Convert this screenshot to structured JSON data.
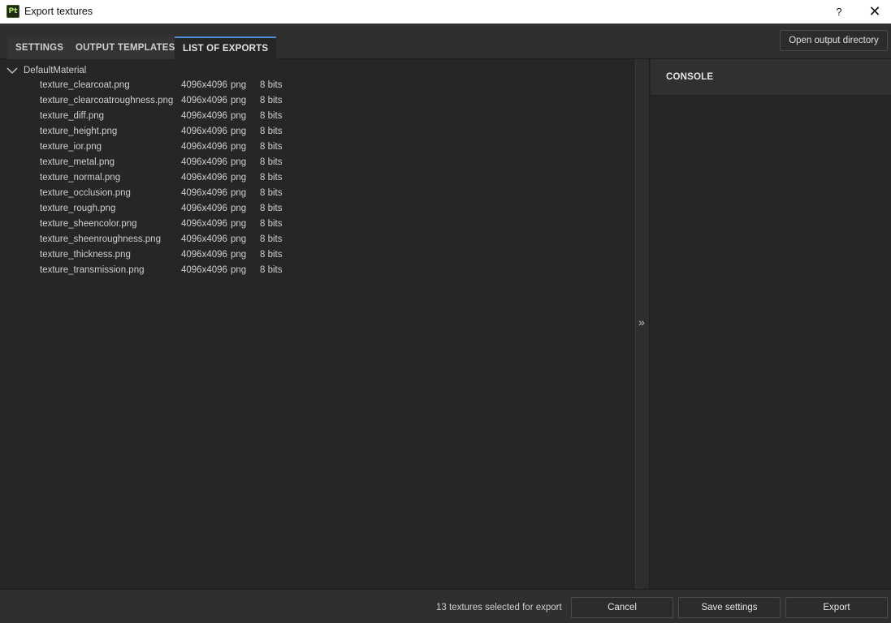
{
  "window": {
    "app_icon_text": "Pt",
    "title": "Export textures",
    "help_label": "?",
    "close_label": "✕"
  },
  "tabs": [
    {
      "label": "SETTINGS",
      "active": false
    },
    {
      "label": "OUTPUT TEMPLATES",
      "active": false
    },
    {
      "label": "LIST OF EXPORTS",
      "active": true
    }
  ],
  "toolbar": {
    "open_output_label": "Open output directory"
  },
  "exports": {
    "group": "DefaultMaterial",
    "rows": [
      {
        "name": "texture_clearcoat.png",
        "size": "4096x4096",
        "format": "png",
        "bits": "8 bits"
      },
      {
        "name": "texture_clearcoatroughness.png",
        "size": "4096x4096",
        "format": "png",
        "bits": "8 bits"
      },
      {
        "name": "texture_diff.png",
        "size": "4096x4096",
        "format": "png",
        "bits": "8 bits"
      },
      {
        "name": "texture_height.png",
        "size": "4096x4096",
        "format": "png",
        "bits": "8 bits"
      },
      {
        "name": "texture_ior.png",
        "size": "4096x4096",
        "format": "png",
        "bits": "8 bits"
      },
      {
        "name": "texture_metal.png",
        "size": "4096x4096",
        "format": "png",
        "bits": "8 bits"
      },
      {
        "name": "texture_normal.png",
        "size": "4096x4096",
        "format": "png",
        "bits": "8 bits"
      },
      {
        "name": "texture_occlusion.png",
        "size": "4096x4096",
        "format": "png",
        "bits": "8 bits"
      },
      {
        "name": "texture_rough.png",
        "size": "4096x4096",
        "format": "png",
        "bits": "8 bits"
      },
      {
        "name": "texture_sheencolor.png",
        "size": "4096x4096",
        "format": "png",
        "bits": "8 bits"
      },
      {
        "name": "texture_sheenroughness.png",
        "size": "4096x4096",
        "format": "png",
        "bits": "8 bits"
      },
      {
        "name": "texture_thickness.png",
        "size": "4096x4096",
        "format": "png",
        "bits": "8 bits"
      },
      {
        "name": "texture_transmission.png",
        "size": "4096x4096",
        "format": "png",
        "bits": "8 bits"
      }
    ]
  },
  "splitter": {
    "arrow": "»"
  },
  "console": {
    "title": "CONSOLE"
  },
  "footer": {
    "status": "13 textures selected for export",
    "cancel_label": "Cancel",
    "save_label": "Save settings",
    "export_label": "Export"
  },
  "colors": {
    "active_tab_accent": "#4a90d9",
    "panel_bg": "#262626",
    "app_icon_fg": "#b6e36b"
  }
}
